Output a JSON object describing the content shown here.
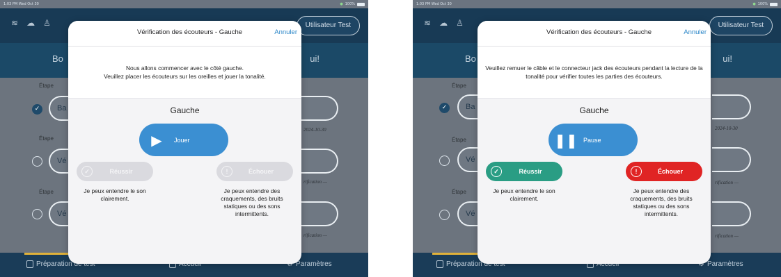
{
  "background": {
    "status_time": "1:03 PM  Wed Oct 30",
    "status_battery": "100%",
    "user_button": "Utilisateur Test",
    "hero_left": "Bo",
    "hero_right": "ui!",
    "step_label": "Étape",
    "step1_button": "Ba",
    "step2_button": "Vé",
    "step3_button": "Vé",
    "step1_date": "2024-10-30",
    "step2_note": "rification —",
    "step3_note": "rification —",
    "nav_prep": "Préparation de test",
    "nav_home": "Accueil",
    "nav_settings": "Paramètres"
  },
  "left": {
    "title": "Vérification des écouteurs - Gauche",
    "cancel": "Annuler",
    "instructions_line1": "Nous allons commencer avec le côté gauche.",
    "instructions_line2": "Veuillez placer les écouteurs sur les oreilles et jouer la tonalité.",
    "side": "Gauche",
    "play_label": "Jouer",
    "pass_label": "Réussir",
    "fail_label": "Échouer",
    "pass_text": "Je peux entendre le son clairement.",
    "fail_text": "Je peux entendre des craquements, des bruits statiques ou des sons intermittents."
  },
  "right": {
    "title": "Vérification des écouteurs - Gauche",
    "cancel": "Annuler",
    "instructions": "Veuillez remuer le câble et le connecteur jack des écouteurs pendant la lecture de la tonalité pour vérifier toutes les parties des écouteurs.",
    "side": "Gauche",
    "pause_label": "Pause",
    "pass_label": "Réussir",
    "fail_label": "Échouer",
    "pass_text": "Je peux entendre le son clairement.",
    "fail_text": "Je peux entendre des craquements, des bruits statiques ou des sons intermittents."
  },
  "colors": {
    "accent_blue": "#3b8fd2",
    "pass_green": "#2a9d84",
    "fail_red": "#e02424",
    "disabled_gray": "#dadadf"
  }
}
